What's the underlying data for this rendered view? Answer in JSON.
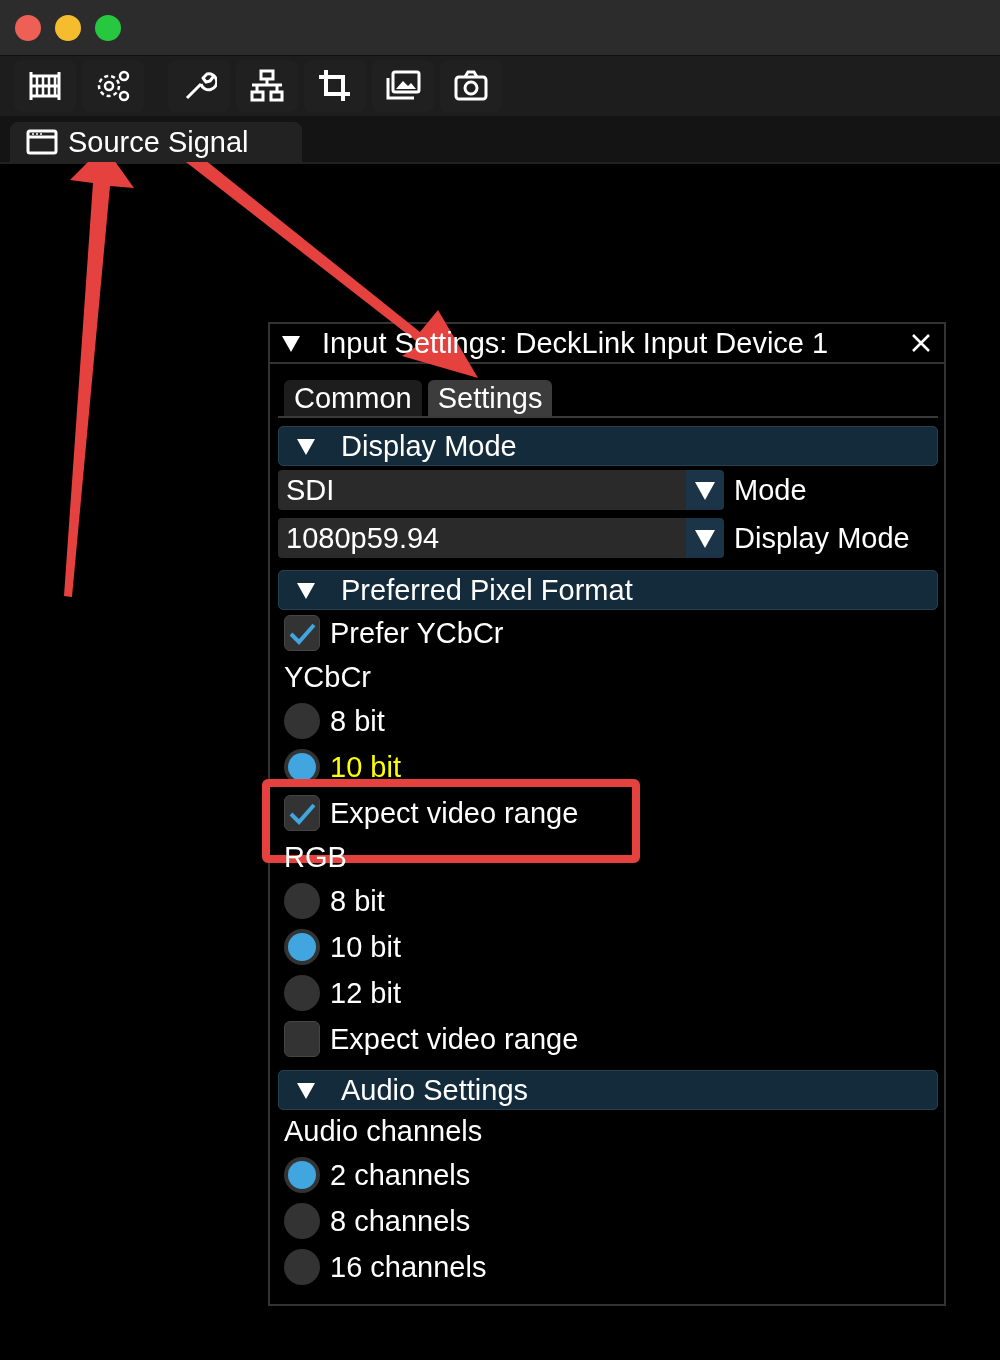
{
  "window": {
    "tabs": [
      {
        "label": "Source Signal",
        "selected": true
      }
    ]
  },
  "panel": {
    "title": "Input Settings: DeckLink Input Device 1",
    "expanded": true,
    "tabs": [
      {
        "label": "Common",
        "selected": false
      },
      {
        "label": "Settings",
        "selected": true
      }
    ],
    "sections": [
      {
        "title": "Display Mode",
        "expanded": true,
        "items": [
          {
            "kind": "combo",
            "value": "SDI",
            "label": "Mode"
          },
          {
            "kind": "combo",
            "value": "1080p59.94",
            "label": "Display Mode"
          }
        ]
      },
      {
        "title": "Preferred Pixel Format",
        "expanded": true,
        "items": [
          {
            "kind": "checkbox",
            "label": "Prefer YCbCr",
            "checked": true,
            "annotated": false
          },
          {
            "kind": "label",
            "label": "YCbCr"
          },
          {
            "kind": "radio",
            "label": "8 bit",
            "selected": false,
            "highlighted": false
          },
          {
            "kind": "radio",
            "label": "10 bit",
            "selected": true,
            "highlighted": true
          },
          {
            "kind": "checkbox",
            "label": "Expect video range",
            "checked": true,
            "annotated": true
          },
          {
            "kind": "label",
            "label": "RGB"
          },
          {
            "kind": "radio",
            "label": "8 bit",
            "selected": false,
            "highlighted": false
          },
          {
            "kind": "radio",
            "label": "10 bit",
            "selected": true,
            "highlighted": false
          },
          {
            "kind": "radio",
            "label": "12 bit",
            "selected": false,
            "highlighted": false
          },
          {
            "kind": "checkbox",
            "label": "Expect video range",
            "checked": false,
            "annotated": false
          }
        ]
      },
      {
        "title": "Audio Settings",
        "expanded": true,
        "items": [
          {
            "kind": "label",
            "label": "Audio channels"
          },
          {
            "kind": "radio",
            "label": "2 channels",
            "selected": true,
            "highlighted": false
          },
          {
            "kind": "radio",
            "label": "8 channels",
            "selected": false,
            "highlighted": false
          },
          {
            "kind": "radio",
            "label": "16 channels",
            "selected": false,
            "highlighted": false
          }
        ]
      }
    ]
  }
}
